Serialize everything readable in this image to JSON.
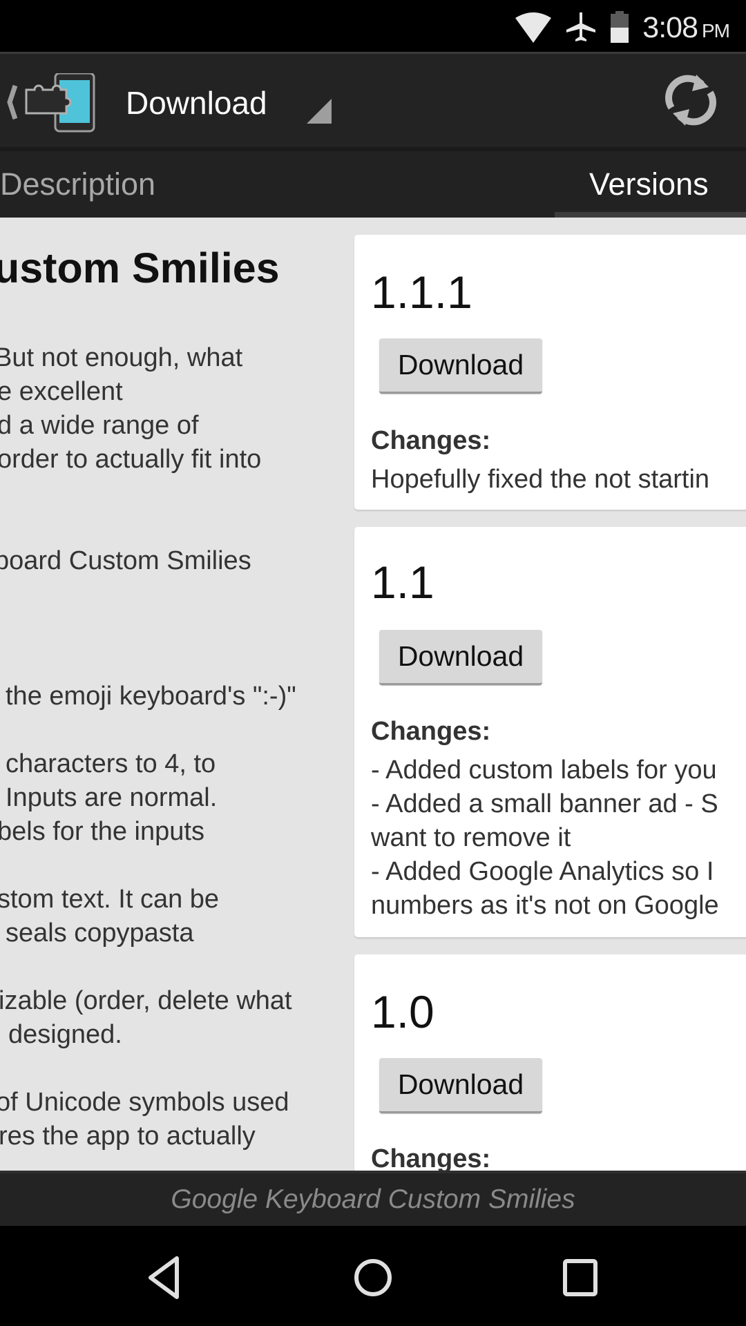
{
  "status_bar": {
    "time": "3:08",
    "ampm": "PM",
    "icons": [
      "wifi-icon",
      "airplane-mode-icon",
      "battery-icon"
    ]
  },
  "action_bar": {
    "app_icon": "xposed-installer-icon",
    "title": "Download",
    "refresh_icon": "refresh-icon"
  },
  "tabs": [
    {
      "label": "Description",
      "selected": false
    },
    {
      "label": "Versions",
      "selected": true
    }
  ],
  "description": {
    "title": "ustom Smilies",
    "lines": [
      "But not enough, what",
      "e excellent",
      "d a wide range of",
      "order to actually fit into",
      "board Custom Smilies",
      "the emoji keyboard's \":-)\"",
      "characters to 4, to",
      "Inputs are normal.",
      "bels for the inputs",
      "stom text. It can be",
      "seals copypasta",
      "izable (order, delete what",
      "designed.",
      "of Unicode symbols used",
      "res the app to actually"
    ]
  },
  "versions": [
    {
      "version": "1.1.1",
      "button_label": "Download",
      "changes_label": "Changes:",
      "changes": [
        "Hopefully fixed the not startin"
      ]
    },
    {
      "version": "1.1",
      "button_label": "Download",
      "changes_label": "Changes:",
      "changes": [
        "- Added custom labels for you",
        "- Added a small banner ad - S",
        "want to remove it",
        "- Added Google Analytics so I",
        "numbers as it's not on Google"
      ]
    },
    {
      "version": "1.0",
      "button_label": "Download",
      "changes_label": "Changes:",
      "changes": []
    }
  ],
  "footer": {
    "module_name": "Google Keyboard Custom Smilies"
  },
  "nav_bar": {
    "back": "back-icon",
    "home": "home-icon",
    "recents": "recents-icon"
  },
  "colors": {
    "accent_blue": "#4fc3d9",
    "action_bar_bg": "#232323",
    "content_bg": "#e4e4e4"
  }
}
